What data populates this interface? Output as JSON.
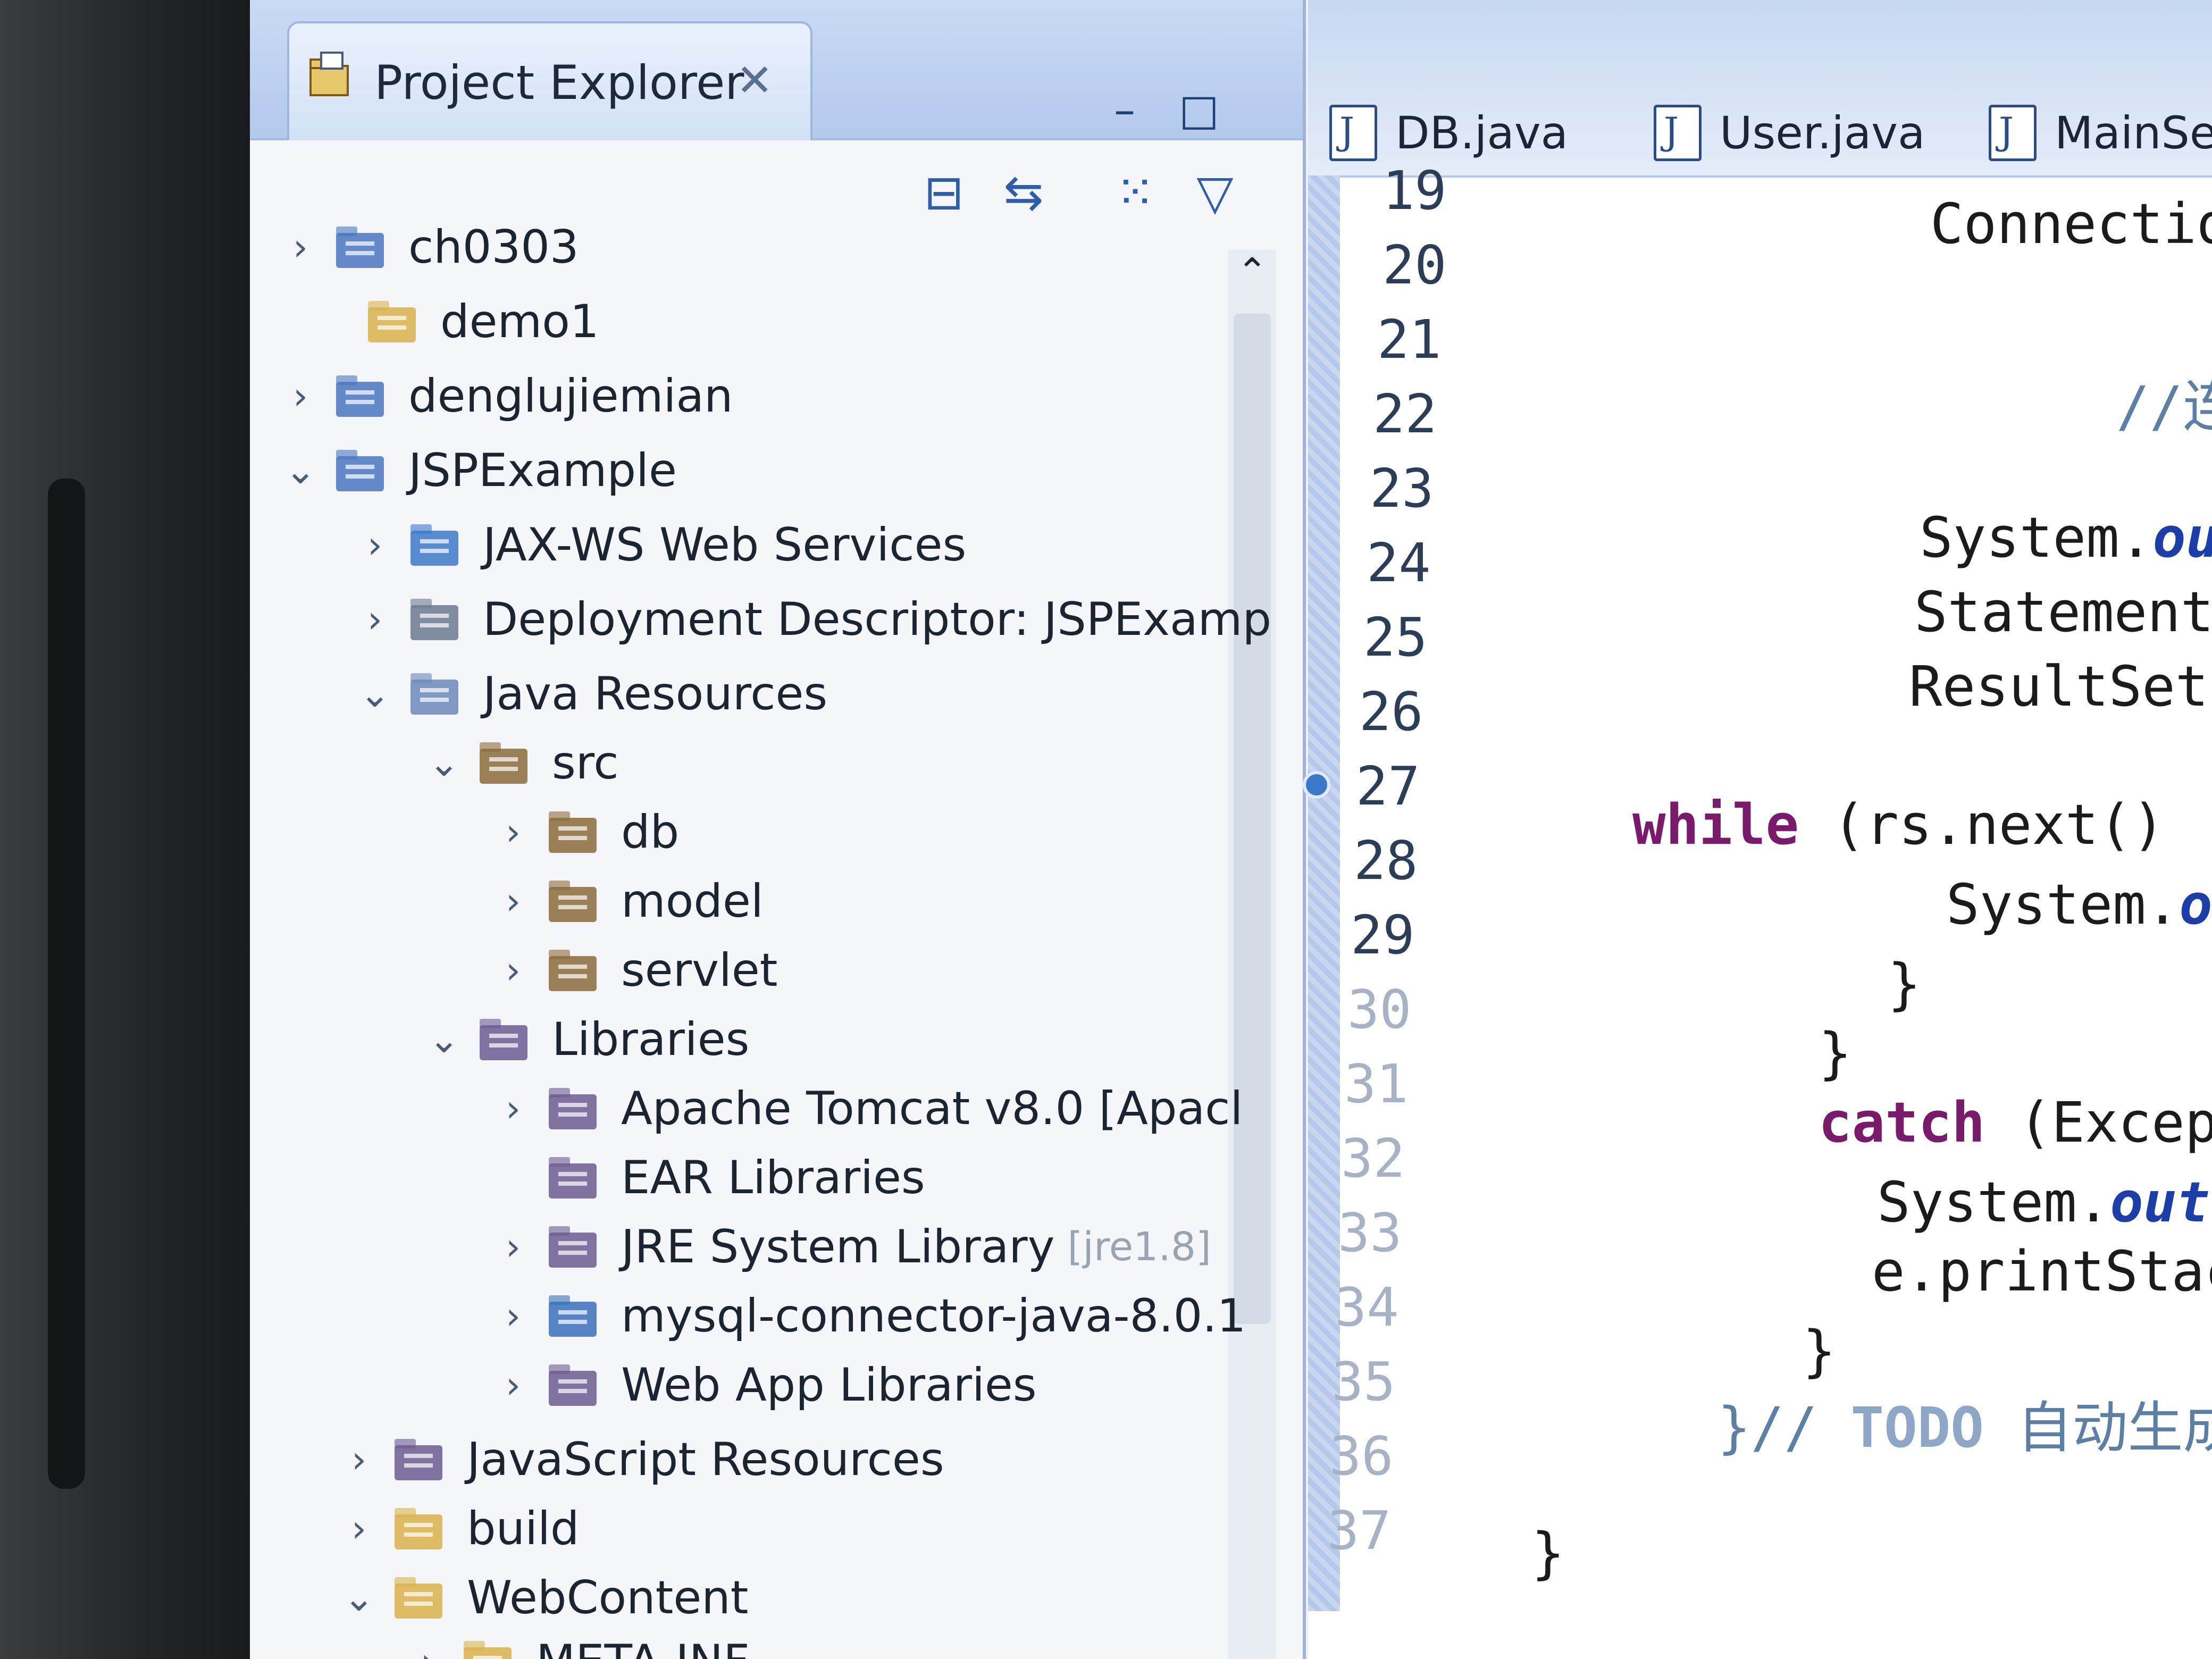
{
  "explorer": {
    "title": "Project Explorer",
    "close_glyph": "✕",
    "minimize_glyph": "–",
    "maximize_glyph": "□",
    "toolbar": {
      "collapse_all_glyph": "⊟",
      "link_glyph": "⇆",
      "filters_glyph": "⁙",
      "menu_glyph": "▽"
    },
    "scroll_up_glyph": "⌃",
    "tree": [
      {
        "label": "ch0303",
        "chevron": "›",
        "icon": "project-icon"
      },
      {
        "label": "demo1",
        "chevron": "",
        "icon": "folder-icon"
      },
      {
        "label": "denglujiemian",
        "chevron": "›",
        "icon": "project-icon"
      },
      {
        "label": "JSPExample",
        "chevron": "⌄",
        "icon": "project-icon"
      },
      {
        "label": "JAX-WS Web Services",
        "chevron": "›",
        "icon": "web-services-icon"
      },
      {
        "label": "Deployment Descriptor: JSPExamp",
        "chevron": "›",
        "icon": "descriptor-icon"
      },
      {
        "label": "Java Resources",
        "chevron": "⌄",
        "icon": "java-resources-icon"
      },
      {
        "label": "src",
        "chevron": "⌄",
        "icon": "source-folder-icon"
      },
      {
        "label": "db",
        "chevron": "›",
        "icon": "package-icon"
      },
      {
        "label": "model",
        "chevron": "›",
        "icon": "package-icon"
      },
      {
        "label": "servlet",
        "chevron": "›",
        "icon": "package-icon"
      },
      {
        "label": "Libraries",
        "chevron": "⌄",
        "icon": "libraries-icon"
      },
      {
        "label": "Apache Tomcat v8.0 [Apacl",
        "chevron": "›",
        "icon": "library-icon"
      },
      {
        "label": "EAR Libraries",
        "chevron": "",
        "icon": "library-icon"
      },
      {
        "label": "JRE System Library",
        "suffix": "[jre1.8]",
        "chevron": "›",
        "icon": "library-icon"
      },
      {
        "label": "mysql-connector-java-8.0.1",
        "chevron": "›",
        "icon": "jar-icon"
      },
      {
        "label": "Web App Libraries",
        "chevron": "›",
        "icon": "library-icon"
      },
      {
        "label": "JavaScript Resources",
        "chevron": "›",
        "icon": "libraries-icon"
      },
      {
        "label": "build",
        "chevron": "›",
        "icon": "folder-icon"
      },
      {
        "label": "WebContent",
        "chevron": "⌄",
        "icon": "folder-icon"
      },
      {
        "label": "META-INF",
        "chevron": "›",
        "icon": "folder-icon"
      }
    ]
  },
  "editor": {
    "tabs": [
      "DB.java",
      "User.java",
      "MainServ"
    ],
    "line_numbers": [
      "19",
      "20",
      "21",
      "22",
      "23",
      "24",
      "25",
      "26",
      "27",
      "28",
      "29",
      "30",
      "31",
      "32",
      "33",
      "34",
      "35",
      "36",
      "37"
    ],
    "code": {
      "l19": "Connectio",
      "l21_comment": "//连",
      "l23_a": "System.",
      "l23_b": "ou",
      "l24": "Statement",
      "l25": "ResultSet",
      "l27_kw": "while",
      "l27_rest": " (rs.next()",
      "l28_a": "System.",
      "l28_b": "o",
      "l29": "}",
      "l30": "}",
      "l31_kw": "catch",
      "l31_rest": " (Except",
      "l32_a": "System.",
      "l32_b": "out",
      "l32_c": ".",
      "l33": "e.printStac",
      "l34": "}",
      "l35_a": "}//",
      "l35_todo": "TODO",
      "l35_cn": "自动生成",
      "l37": "}"
    }
  }
}
